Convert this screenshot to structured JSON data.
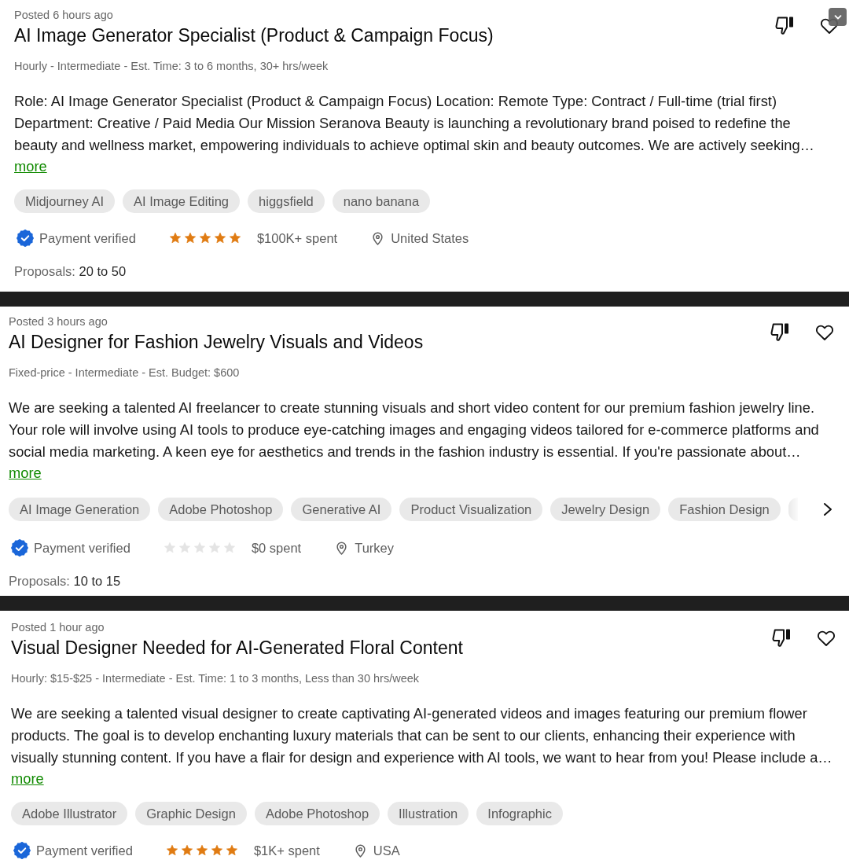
{
  "scroll_button": true,
  "cards": [
    {
      "posted": "Posted 6 hours ago",
      "title": "AI Image Generator Specialist (Product & Campaign Focus)",
      "meta": "Hourly - Intermediate - Est. Time: 3 to 6 months, 30+ hrs/week",
      "description": [
        "Role: AI Image Generator Specialist (Product & Campaign Focus) Location: Remote Type: Contract / Full-time (trial first)",
        "Department: Creative / Paid Media Our Mission Seranova Beauty is launching a revolutionary brand poised to redefine the",
        "beauty and wellness market, empowering individuals to achieve optimal skin and beauty outcomes. We are actively seeking…"
      ],
      "more": "more",
      "tags": [
        "Midjourney AI",
        "AI Image Editing",
        "higgsfield",
        "nano banana"
      ],
      "client": {
        "payment": "Payment verified",
        "stars": 5,
        "spent": "$100K+ spent",
        "location": "United States"
      },
      "proposals": "Proposals: **20 to 50**"
    },
    {
      "posted": "Posted 3 hours ago",
      "title": "AI Designer for Fashion Jewelry Visuals and Videos",
      "meta": "Fixed-price - Intermediate - Est. Budget: $600",
      "description": [
        "We are seeking a talented AI freelancer to create stunning visuals and short video content for our premium fashion jewelry line.",
        "Your role will involve using AI tools to produce eye-catching images and engaging videos tailored for e-commerce platforms and",
        "social media marketing. A keen eye for aesthetics and trends in the fashion industry is essential. If you're passionate about…"
      ],
      "more": "more",
      "tags": [
        "AI Image Generation",
        "Adobe Photoshop",
        "Generative AI",
        "Product Visualization",
        "Jewelry Design",
        "Fashion Design"
      ],
      "tags_overflow": true,
      "client": {
        "payment": "Payment verified",
        "stars": 0,
        "spent": "$0 spent",
        "location": "Turkey"
      },
      "proposals": "Proposals: **10 to 15**"
    },
    {
      "posted": "Posted 1 hour ago",
      "title": "Visual Designer Needed for AI-Generated Floral Content",
      "meta": "Hourly: $15-$25 - Intermediate - Est. Time: 1 to 3 months, Less than 30 hrs/week",
      "description": [
        "We are seeking a talented visual designer to create captivating AI-generated videos and images featuring our premium flower",
        "products. The goal is to develop enchanting luxury materials that can be sent to our clients, enhancing their experience with",
        "visually stunning content. If you have a flair for design and experience with AI tools, we want to hear from you! Please include a…"
      ],
      "more": "more",
      "tags": [
        "Adobe Illustrator",
        "Graphic Design",
        "Adobe Photoshop",
        "Illustration",
        "Infographic"
      ],
      "client": {
        "payment": "Payment verified",
        "stars": 5,
        "spent": "$1K+ spent",
        "location": "USA"
      }
    }
  ]
}
